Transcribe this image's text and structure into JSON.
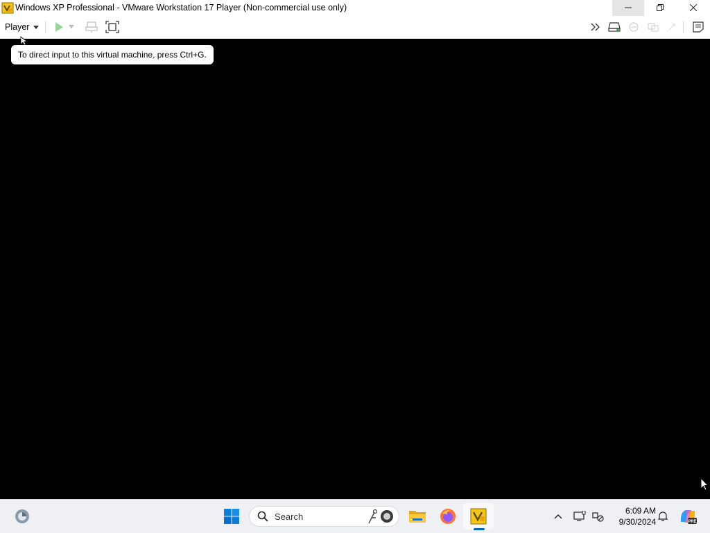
{
  "window": {
    "title": "Windows XP Professional - VMware Workstation 17 Player (Non-commercial use only)",
    "icon": "vmware-player-icon",
    "controls": [
      "minimize-icon",
      "restore-icon",
      "close-icon"
    ]
  },
  "toolbar": {
    "player_menu_label": "Player",
    "icons": [
      "play-icon",
      "play-dropdown-icon",
      "send-ctrl-alt-del-icon",
      "fullscreen-icon",
      "collapse-toolbar-icon",
      "removable-device-icon",
      "network-icon",
      "shared-folders-icon",
      "usb-icon",
      "message-log-icon"
    ]
  },
  "vm": {
    "tooltip_text": "To direct input to this virtual machine, press Ctrl+G."
  },
  "taskbar": {
    "search_label": "Search",
    "pinned": [
      "widgets-icon",
      "start-icon",
      "file-explorer-icon",
      "firefox-icon",
      "vmware-icon"
    ],
    "tray_icons": [
      "show-hidden-icons-chevron",
      "display-icon",
      "network-tray-icon",
      "notifications-icon",
      "copilot-icon"
    ],
    "copilot_badge": "PRE",
    "time": "6:09 AM",
    "date": "9/30/2024"
  },
  "colors": {
    "accent": "#0067c0",
    "vm_background": "#000000",
    "titlebar_bg": "#ffffff",
    "taskbar_bg": "#eef0f4"
  }
}
